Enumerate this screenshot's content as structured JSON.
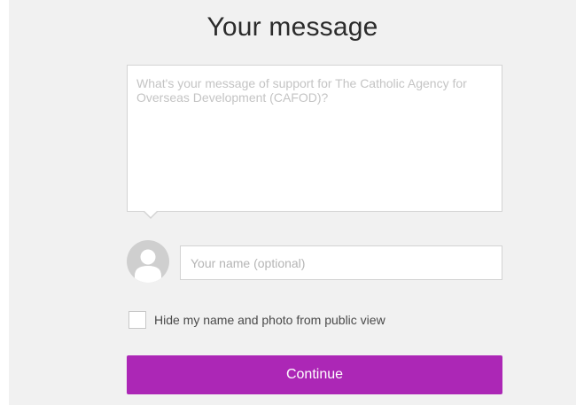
{
  "form": {
    "title": "Your message",
    "message_placeholder": "What's your message of support for The Catholic Agency for Overseas Development (CAFOD)?",
    "message_value": "",
    "name_placeholder": "Your name (optional)",
    "name_value": "",
    "hide_label": "Hide my name and photo from public view",
    "hide_checked": false,
    "avatar_icon": "user-avatar-icon",
    "continue_label": "Continue"
  },
  "colors": {
    "panel_background": "#f1f1f1",
    "button_accent": "#ac27b6",
    "avatar_gray": "#cfcfcf"
  }
}
